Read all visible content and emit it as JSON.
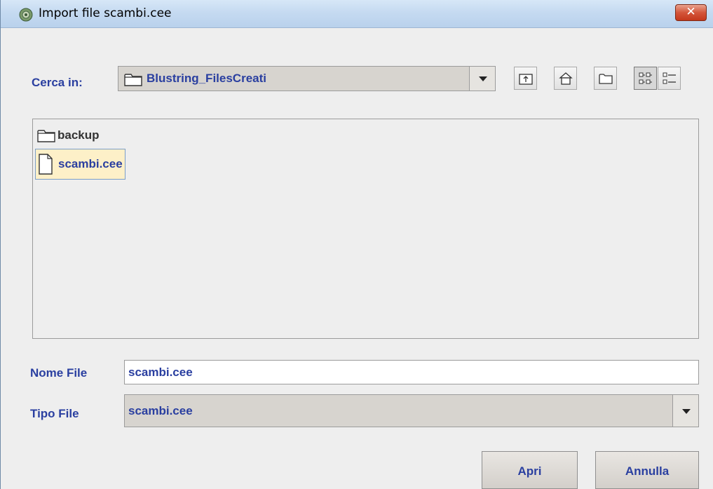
{
  "window": {
    "title": "Import file scambi.cee",
    "close_glyph": "✕"
  },
  "toolbar": {
    "look_in_label": "Cerca in:",
    "current_folder": "Blustring_FilesCreati",
    "buttons": [
      {
        "icon": "up-folder-icon"
      },
      {
        "icon": "home-icon"
      },
      {
        "icon": "new-folder-icon"
      },
      {
        "icon": "list-view-icon",
        "active": true
      },
      {
        "icon": "details-view-icon"
      }
    ]
  },
  "files": [
    {
      "name": "backup",
      "type": "folder",
      "selected": false
    },
    {
      "name": "scambi.cee",
      "type": "file",
      "selected": true
    }
  ],
  "form": {
    "file_name_label": "Nome File",
    "file_name_value": "scambi.cee",
    "file_type_label": "Tipo File",
    "file_type_value": "scambi.cee"
  },
  "actions": {
    "open_label": "Apri",
    "cancel_label": "Annulla"
  },
  "colors": {
    "label_blue": "#2a3fa0",
    "selection_bg": "#fdf0c8",
    "close_red": "#c4381c"
  }
}
